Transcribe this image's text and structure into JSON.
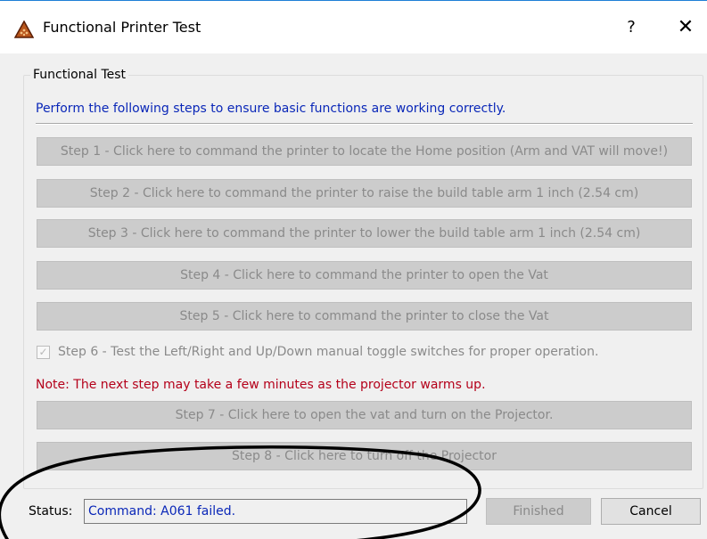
{
  "window": {
    "title": "Functional Printer Test",
    "help_label": "?",
    "close_label": "✕",
    "icon": "triangle-logo-icon"
  },
  "group": {
    "label": "Functional Test",
    "intro": "Perform the following steps to ensure basic functions are working correctly."
  },
  "steps": [
    "Step 1 - Click here to command the printer to locate the Home position (Arm and VAT will move!)",
    "Step 2 - Click here to command the printer to raise the build table arm 1 inch (2.54 cm)",
    "Step 3 - Click here to command the printer to lower the build table arm 1 inch (2.54 cm)",
    "Step 4 - Click here to command the printer to open the Vat",
    "Step 5 - Click here to command the printer to close the Vat"
  ],
  "step6": {
    "label": "Step 6 - Test the Left/Right and Up/Down manual toggle switches for proper operation.",
    "checked": true
  },
  "note": "Note: The next step may take a few minutes as the projector warms up.",
  "steps_after": [
    "Step 7 - Click here to open the vat and turn on the Projector.",
    "Step 8 - Click here to turn off the Projector"
  ],
  "status": {
    "label": "Status:",
    "value": "Command: A061 failed."
  },
  "buttons": {
    "finished": "Finished",
    "cancel": "Cancel"
  },
  "colors": {
    "intro_text": "#0a27b8",
    "note_text": "#b4001a",
    "disabled_text": "#8a8a8a",
    "title_border": "#1e7fd6"
  }
}
